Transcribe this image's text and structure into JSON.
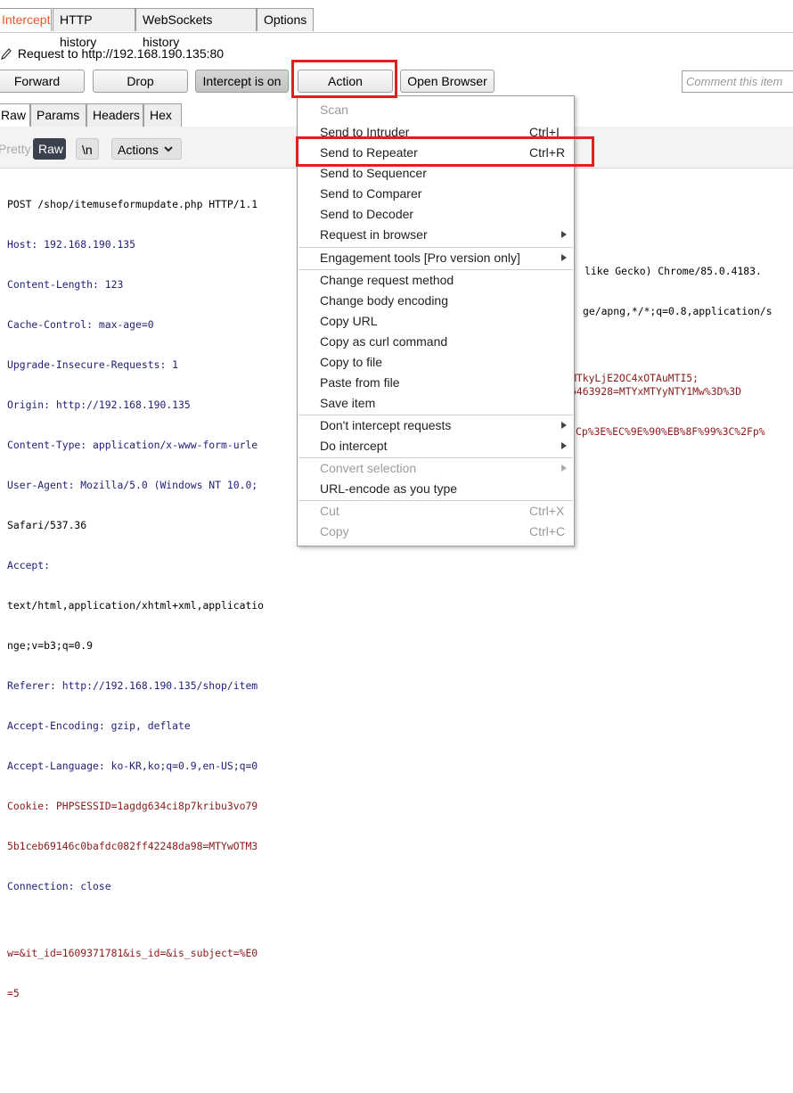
{
  "top_tabs": [
    "Intercept",
    "HTTP history",
    "WebSockets history",
    "Options"
  ],
  "request_line": "Request to http://192.168.190.135:80",
  "buttons": {
    "forward": "Forward",
    "drop": "Drop",
    "intercept": "Intercept is on",
    "action": "Action",
    "open_browser": "Open Browser"
  },
  "comment_placeholder": "Comment this item",
  "sub_tabs": [
    "Raw",
    "Params",
    "Headers",
    "Hex"
  ],
  "editor_toolbar": {
    "pretty": "Pretty",
    "raw": "Raw",
    "newline": "\\n",
    "actions": "Actions"
  },
  "editor_lines": [
    "POST /shop/itemuseformupdate.php HTTP/1.1",
    "Host: 192.168.190.135",
    "Content-Length: 123",
    "Cache-Control: max-age=0",
    "Upgrade-Insecure-Requests: 1",
    "Origin: http://192.168.190.135",
    "Content-Type: application/x-www-form-urle",
    "User-Agent: Mozilla/5.0 (Windows NT 10.0;",
    "Safari/537.36",
    "Accept:",
    "text/html,application/xhtml+xml,applicatio",
    "nge;v=b3;q=0.9",
    "Referer: http://192.168.190.135/shop/item",
    "Accept-Encoding: gzip, deflate",
    "Accept-Language: ko-KR,ko;q=0.9,en-US;q=0",
    "Cookie: PHPSESSID=1agdg634ci8p7kribu3vo79",
    "5b1ceb69146c0bafdc082ff42248da98=MTYwOTM3",
    "Connection: close",
    "",
    "w=&it_id=1609371781&is_id=&is_subject=%E0",
    "=5"
  ],
  "editor_right_fragments": {
    "user_agent_tail": "like Gecko) Chrome/85.0.4183.",
    "accept_tail": "ge/apng,*/*;q=0.8,application/s",
    "cookie_tail": "MTkyLjE2OC4xOTAuMTI5;",
    "cookie2_tail": "6463928=MTYxMTYyNTY1Mw%3D%3D",
    "body_tail": "Cp%3E%EC%9E%90%EB%8F%99%3C%2Fp%"
  },
  "menu": {
    "items": [
      {
        "label": "Scan",
        "shortcut": "",
        "disabled": true,
        "submenu": false
      },
      {
        "label": "Send to Intruder",
        "shortcut": "Ctrl+I",
        "disabled": false,
        "submenu": false
      },
      {
        "label": "Send to Repeater",
        "shortcut": "Ctrl+R",
        "disabled": false,
        "submenu": false
      },
      {
        "label": "Send to Sequencer",
        "shortcut": "",
        "disabled": false,
        "submenu": false
      },
      {
        "label": "Send to Comparer",
        "shortcut": "",
        "disabled": false,
        "submenu": false
      },
      {
        "label": "Send to Decoder",
        "shortcut": "",
        "disabled": false,
        "submenu": false
      },
      {
        "label": "Request in browser",
        "shortcut": "",
        "disabled": false,
        "submenu": true
      },
      {
        "label": "Engagement tools [Pro version only]",
        "shortcut": "",
        "disabled": false,
        "submenu": true
      },
      {
        "label": "Change request method",
        "shortcut": "",
        "disabled": false,
        "submenu": false
      },
      {
        "label": "Change body encoding",
        "shortcut": "",
        "disabled": false,
        "submenu": false
      },
      {
        "label": "Copy URL",
        "shortcut": "",
        "disabled": false,
        "submenu": false
      },
      {
        "label": "Copy as curl command",
        "shortcut": "",
        "disabled": false,
        "submenu": false
      },
      {
        "label": "Copy to file",
        "shortcut": "",
        "disabled": false,
        "submenu": false
      },
      {
        "label": "Paste from file",
        "shortcut": "",
        "disabled": false,
        "submenu": false
      },
      {
        "label": "Save item",
        "shortcut": "",
        "disabled": false,
        "submenu": false
      },
      {
        "label": "Don't intercept requests",
        "shortcut": "",
        "disabled": false,
        "submenu": true
      },
      {
        "label": "Do intercept",
        "shortcut": "",
        "disabled": false,
        "submenu": true
      },
      {
        "label": "Convert selection",
        "shortcut": "",
        "disabled": true,
        "submenu": true
      },
      {
        "label": "URL-encode as you type",
        "shortcut": "",
        "disabled": false,
        "submenu": false
      },
      {
        "label": "Cut",
        "shortcut": "Ctrl+X",
        "disabled": true,
        "submenu": false
      },
      {
        "label": "Copy",
        "shortcut": "Ctrl+C",
        "disabled": true,
        "submenu": false
      }
    ]
  },
  "colors": {
    "highlight": "#e02020",
    "active_tab_text": "#e8562a",
    "raw_toggle_bg": "#3c4150"
  }
}
